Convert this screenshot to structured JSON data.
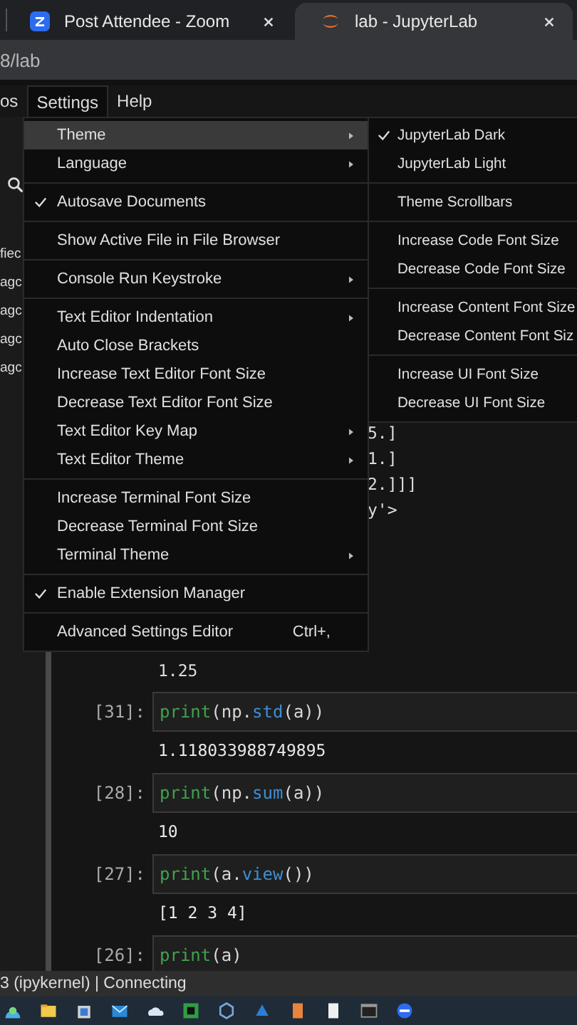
{
  "browser": {
    "tabs": [
      {
        "title": "Post Attendee - Zoom",
        "selected": false
      },
      {
        "title": "lab - JupyterLab",
        "selected": true
      }
    ],
    "address": "8/lab"
  },
  "menubar": [
    {
      "label": "os",
      "selected": false
    },
    {
      "label": "Settings",
      "selected": true
    },
    {
      "label": "Help",
      "selected": false
    }
  ],
  "file_browser": {
    "items": [
      "fiec",
      "agc",
      "agc",
      "agc",
      "agc"
    ]
  },
  "settings_menu": {
    "groups": [
      [
        {
          "label": "Theme",
          "checked": false,
          "submenu": true,
          "selected": true
        },
        {
          "label": "Language",
          "checked": false,
          "submenu": true,
          "selected": false
        }
      ],
      [
        {
          "label": "Autosave Documents",
          "checked": true,
          "submenu": false,
          "selected": false
        }
      ],
      [
        {
          "label": "Show Active File in File Browser",
          "checked": false,
          "submenu": false,
          "selected": false
        }
      ],
      [
        {
          "label": "Console Run Keystroke",
          "checked": false,
          "submenu": true,
          "selected": false
        }
      ],
      [
        {
          "label": "Text Editor Indentation",
          "checked": false,
          "submenu": true,
          "selected": false
        },
        {
          "label": "Auto Close Brackets",
          "checked": false,
          "submenu": false,
          "selected": false
        },
        {
          "label": "Increase Text Editor Font Size",
          "checked": false,
          "submenu": false,
          "selected": false
        },
        {
          "label": "Decrease Text Editor Font Size",
          "checked": false,
          "submenu": false,
          "selected": false
        },
        {
          "label": "Text Editor Key Map",
          "checked": false,
          "submenu": true,
          "selected": false
        },
        {
          "label": "Text Editor Theme",
          "checked": false,
          "submenu": true,
          "selected": false
        }
      ],
      [
        {
          "label": "Increase Terminal Font Size",
          "checked": false,
          "submenu": false,
          "selected": false
        },
        {
          "label": "Decrease Terminal Font Size",
          "checked": false,
          "submenu": false,
          "selected": false
        },
        {
          "label": "Terminal Theme",
          "checked": false,
          "submenu": true,
          "selected": false
        }
      ],
      [
        {
          "label": "Enable Extension Manager",
          "checked": true,
          "submenu": false,
          "selected": false
        }
      ],
      [
        {
          "label": "Advanced Settings Editor",
          "checked": false,
          "submenu": false,
          "selected": false,
          "shortcut": "Ctrl+,"
        }
      ]
    ]
  },
  "theme_submenu": {
    "groups": [
      [
        {
          "label": "JupyterLab Dark",
          "checked": true,
          "selected": false
        },
        {
          "label": "JupyterLab Light",
          "checked": false,
          "selected": false
        }
      ],
      [
        {
          "label": "Theme Scrollbars",
          "checked": false,
          "selected": false
        }
      ],
      [
        {
          "label": "Increase Code Font Size",
          "checked": false,
          "selected": false
        },
        {
          "label": "Decrease Code Font Size",
          "checked": false,
          "selected": false
        }
      ],
      [
        {
          "label": "Increase Content Font Size",
          "checked": false,
          "selected": false
        },
        {
          "label": "Decrease Content Font Siz",
          "checked": false,
          "selected": false
        }
      ],
      [
        {
          "label": "Increase UI Font Size",
          "checked": false,
          "selected": false
        },
        {
          "label": "Decrease UI Font Size",
          "checked": false,
          "selected": false
        }
      ]
    ]
  },
  "notebook": {
    "output_lines": [
      "5.]",
      "1.]",
      "2.]]]",
      "y'>"
    ],
    "partial_output": "1.25",
    "cells": [
      {
        "prompt": "[31]:",
        "code": [
          {
            "text": "print",
            "kind": "builtin"
          },
          {
            "text": "(np.",
            "kind": "plain"
          },
          {
            "text": "std",
            "kind": "attr"
          },
          {
            "text": "(a))",
            "kind": "plain"
          }
        ],
        "output": "1.118033988749895"
      },
      {
        "prompt": "[28]:",
        "code": [
          {
            "text": "print",
            "kind": "builtin"
          },
          {
            "text": "(np.",
            "kind": "plain"
          },
          {
            "text": "sum",
            "kind": "attr"
          },
          {
            "text": "(a))",
            "kind": "plain"
          }
        ],
        "output": "10"
      },
      {
        "prompt": "[27]:",
        "code": [
          {
            "text": "print",
            "kind": "builtin"
          },
          {
            "text": "(a.",
            "kind": "plain"
          },
          {
            "text": "view",
            "kind": "attr"
          },
          {
            "text": "())",
            "kind": "plain"
          }
        ],
        "output": "[1 2 3 4]"
      },
      {
        "prompt": "[26]:",
        "code": [
          {
            "text": "print",
            "kind": "builtin"
          },
          {
            "text": "(a)",
            "kind": "plain"
          }
        ]
      }
    ]
  },
  "status_bar": "3 (ipykernel) | Connecting"
}
